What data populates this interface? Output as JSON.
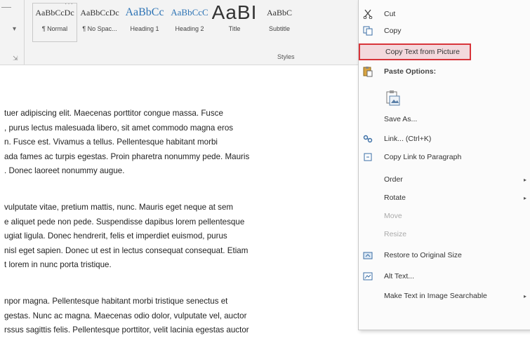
{
  "ribbon": {
    "styles": [
      {
        "sample": "AaBbCcDc",
        "label": "¶ Normal",
        "cls": "",
        "selected": true
      },
      {
        "sample": "AaBbCcDc",
        "label": "¶ No Spac...",
        "cls": ""
      },
      {
        "sample": "AaBbCc",
        "label": "Heading 1",
        "cls": "h1"
      },
      {
        "sample": "AaBbCcC",
        "label": "Heading 2",
        "cls": "h2"
      },
      {
        "sample": "AaBI",
        "label": "Title",
        "cls": "title"
      },
      {
        "sample": "AaBbC",
        "label": "Subtitle",
        "cls": ""
      }
    ],
    "group_label": "Styles"
  },
  "document": {
    "paragraphs": [
      [
        "tuer adipiscing elit. Maecenas porttitor congue massa. Fusce",
        ", purus lectus malesuada libero, sit amet commodo magna eros",
        "n. Fusce est. Vivamus a tellus. Pellentesque habitant morbi",
        "ada fames ac turpis egestas. Proin pharetra nonummy pede. Mauris",
        ". Donec laoreet nonummy augue."
      ],
      [
        " vulputate vitae, pretium mattis, nunc. Mauris eget neque at sem",
        "e aliquet pede non pede. Suspendisse dapibus lorem pellentesque",
        "ugiat ligula. Donec hendrerit, felis et imperdiet euismod, purus",
        "nisl eget sapien. Donec ut est in lectus consequat consequat. Etiam",
        "t lorem in nunc porta tristique."
      ],
      [
        "npor magna. Pellentesque habitant morbi tristique senectus et",
        "gestas. Nunc ac magna. Maecenas odio dolor, vulputate vel, auctor",
        "rssus sagittis felis. Pellentesque porttitor, velit lacinia egestas auctor"
      ]
    ]
  },
  "context_menu": {
    "cut": "Cut",
    "copy": "Copy",
    "copy_text_from_picture": "Copy Text from Picture",
    "paste_options": "Paste Options:",
    "save_as": "Save As...",
    "link": "Link...  (Ctrl+K)",
    "copy_link_to_paragraph": "Copy Link to Paragraph",
    "order": "Order",
    "rotate": "Rotate",
    "move": "Move",
    "resize": "Resize",
    "restore_original_size": "Restore to Original Size",
    "alt_text": "Alt Text...",
    "make_text_searchable": "Make Text in Image Searchable",
    "highlight_color": "#d8343a"
  }
}
